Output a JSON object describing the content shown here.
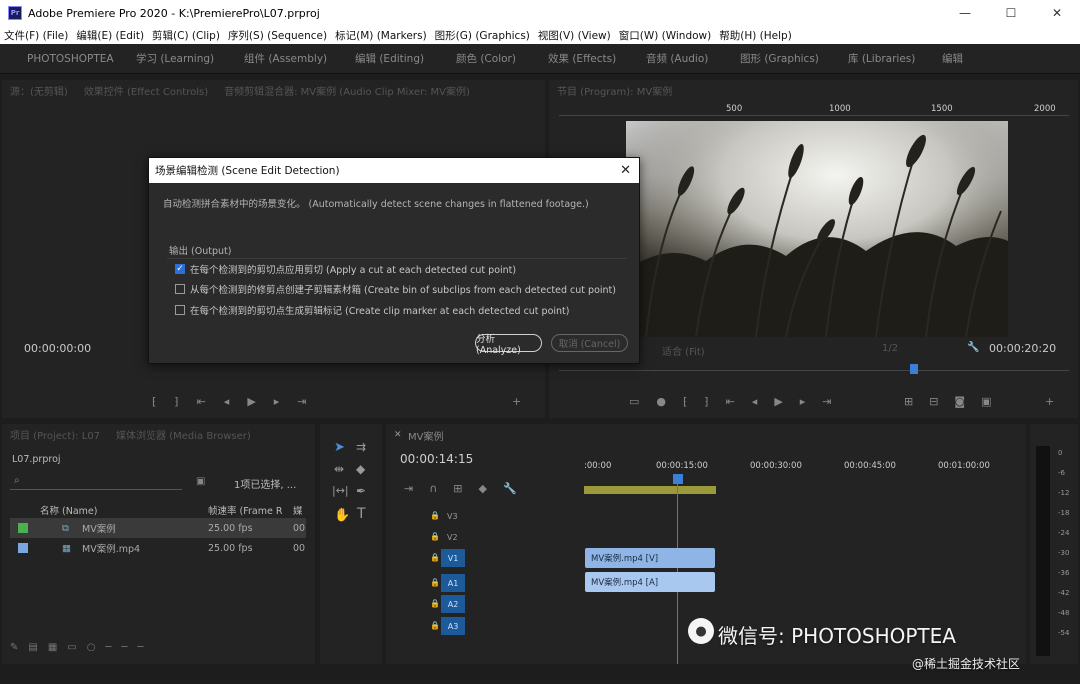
{
  "window": {
    "icon_text": "Pr",
    "title": "Adobe Premiere Pro 2020 - K:\\PremierePro\\L07.prproj",
    "minimize": "—",
    "maximize": "☐",
    "close": "✕"
  },
  "menubar": {
    "items": [
      "文件(F) (File)",
      "编辑(E) (Edit)",
      "剪辑(C) (Clip)",
      "序列(S) (Sequence)",
      "标记(M) (Markers)",
      "图形(G) (Graphics)",
      "视图(V) (View)",
      "窗口(W) (Window)",
      "帮助(H) (Help)"
    ]
  },
  "workspaces": {
    "items": [
      "PHOTOSHOPTEA",
      "学习 (Learning)",
      "组件 (Assembly)",
      "编辑 (Editing)",
      "颜色 (Color)",
      "效果 (Effects)",
      "音频 (Audio)",
      "图形 (Graphics)",
      "库 (Libraries)",
      "编辑"
    ]
  },
  "source_panel": {
    "tabs": [
      "源：(无剪辑)",
      "效果控件 (Effect Controls)",
      "音频剪辑混合器: MV案例 (Audio Clip Mixer: MV案例)"
    ],
    "timecode": "00:00:00:00"
  },
  "program_panel": {
    "tab": "节目 (Program): MV案例",
    "timecode_right": "00:00:20:20",
    "fit_label": "适合 (Fit)",
    "quality": "1/2",
    "ruler": [
      "500",
      "1000",
      "1500",
      "2000"
    ]
  },
  "dialog": {
    "title": "场景编辑检测 (Scene Edit Detection)",
    "close": "✕",
    "description": "自动检测拼合素材中的场景变化。 (Automatically detect scene changes in flattened footage.)",
    "group_label": "输出 (Output)",
    "options": [
      {
        "label": "在每个检测到的剪切点应用剪切 (Apply a cut at each detected cut point)",
        "checked": true
      },
      {
        "label": "从每个检测到的修剪点创建子剪辑素材箱 (Create bin of subclips from each detected cut point)",
        "checked": false
      },
      {
        "label": "在每个检测到的剪切点生成剪辑标记 (Create clip marker at each detected cut point)",
        "checked": false
      }
    ],
    "analyze_button": "分析 (Analyze)",
    "cancel_button": "取消 (Cancel)"
  },
  "project_panel": {
    "tabs": [
      "项目 (Project): L07",
      "媒体浏览器 (Media Browser)"
    ],
    "project_file": "L07.prproj",
    "selection_info": "1项已选择, ...",
    "columns": {
      "name": "名称 (Name)",
      "framerate": "帧速率 (Frame R",
      "media": "媒"
    },
    "rows": [
      {
        "name": "MV案例",
        "fps": "25.00 fps",
        "extra": "00",
        "color": "#4caf50"
      },
      {
        "name": "MV案例.mp4",
        "fps": "25.00 fps",
        "extra": "00",
        "color": "#7ba7e0"
      }
    ]
  },
  "timeline": {
    "tab": "MV案例",
    "timecode": "00:00:14:15",
    "ruler": [
      ":00:00",
      "00:00:15:00",
      "00:00:30:00",
      "00:00:45:00",
      "00:01:00:00"
    ],
    "tracks": [
      "V3",
      "V2",
      "V1",
      "A1",
      "A2",
      "A3"
    ],
    "video_clip": "MV案例.mp4 [V]",
    "audio_clip": "MV案例.mp4 [A]"
  },
  "meter_labels": [
    "0",
    "-6",
    "-12",
    "-18",
    "-24",
    "-30",
    "-36",
    "-42",
    "-48",
    "-54"
  ],
  "watermark": {
    "main": "微信号: PHOTOSHOPTEA",
    "secondary": "@稀土掘金技术社区"
  },
  "colors": {
    "accent": "#2d6fd6",
    "clip_video": "#8fb5e6",
    "clip_audio": "#a9c8f0",
    "track_active": "#1c5a9a"
  }
}
